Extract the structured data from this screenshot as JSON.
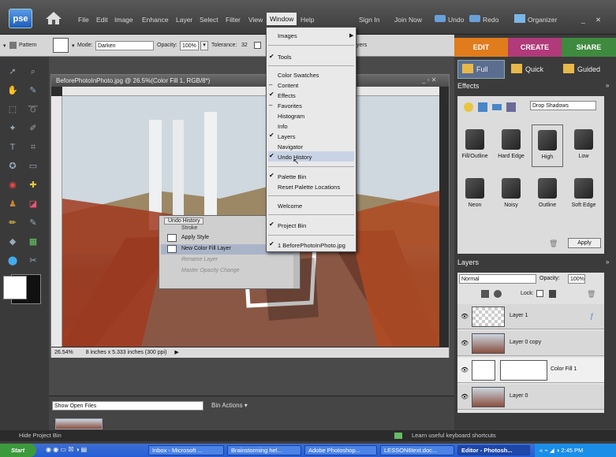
{
  "menubar": {
    "logo": "pse",
    "items": [
      "File",
      "Edit",
      "Image",
      "Enhance",
      "Layer",
      "Select",
      "Filter",
      "View",
      "Window",
      "Help"
    ],
    "sign_in": "Sign In",
    "join_now": "Join Now",
    "undo": "Undo",
    "redo": "Redo",
    "organizer": "Organizer"
  },
  "options": {
    "pattern": "Pattern",
    "mode_label": "Mode:",
    "mode_value": "Darken",
    "opacity_label": "Opacity:",
    "opacity_value": "100%",
    "tolerance_label": "Tolerance:",
    "tolerance_value": "32",
    "layers_frag": "yers"
  },
  "document": {
    "title": "BeforePhotoInPhoto.jpg @ 26.5%(Color Fill 1, RGB/8*)",
    "zoom": "26.54%",
    "dims": "8 inches x 5.333 inches (300 ppi)"
  },
  "undo_history": {
    "title": "Undo History",
    "rows": [
      "Stroke",
      "Apply Style",
      "New Color Fill Layer",
      "Rename Layer",
      "Master Opacity Change"
    ]
  },
  "window_menu": {
    "images": "Images",
    "tools": "Tools",
    "color_swatches": "Color Swatches",
    "content": "Content",
    "effects": "Effects",
    "favorites": "Favorites",
    "histogram": "Histogram",
    "info": "Info",
    "layers": "Layers",
    "navigator": "Navigator",
    "undo_history": "Undo History",
    "palette_bin": "Palette Bin",
    "reset_palettes": "Reset Palette Locations",
    "welcome": "Welcome",
    "project_bin": "Project Bin",
    "doc": "1 BeforePhotoInPhoto.jpg"
  },
  "panel": {
    "tabs": [
      "EDIT",
      "CREATE",
      "SHARE"
    ],
    "modes": [
      "Full",
      "Quick",
      "Guided"
    ],
    "effects_title": "Effects",
    "effects_dropdown": "Drop Shadows",
    "effects": [
      "Fill/Outline",
      "Hard Edge",
      "High",
      "Low",
      "Neon",
      "Noisy",
      "Outline",
      "Soft Edge"
    ],
    "apply": "Apply",
    "layers_title": "Layers",
    "blend": "Normal",
    "opacity_label": "Opacity:",
    "opacity": "100%",
    "lock": "Lock:",
    "layer_names": [
      "Layer 1",
      "Layer 0 copy",
      "Color Fill 1",
      "Layer 0"
    ]
  },
  "bin": {
    "dropdown": "Show Open Files",
    "actions": "Bin Actions ▾"
  },
  "bottom": {
    "hide": "Hide Project Bin",
    "tip": "Learn useful keyboard shortcuts"
  },
  "taskbar": {
    "start": "Start",
    "tasks": [
      "Inbox - Microsoft ...",
      "Brainstorming hel...",
      "Adobe Photoshop...",
      "LESSON6text.doc...",
      "Editor - Photosh..."
    ],
    "time": "2:45 PM"
  }
}
